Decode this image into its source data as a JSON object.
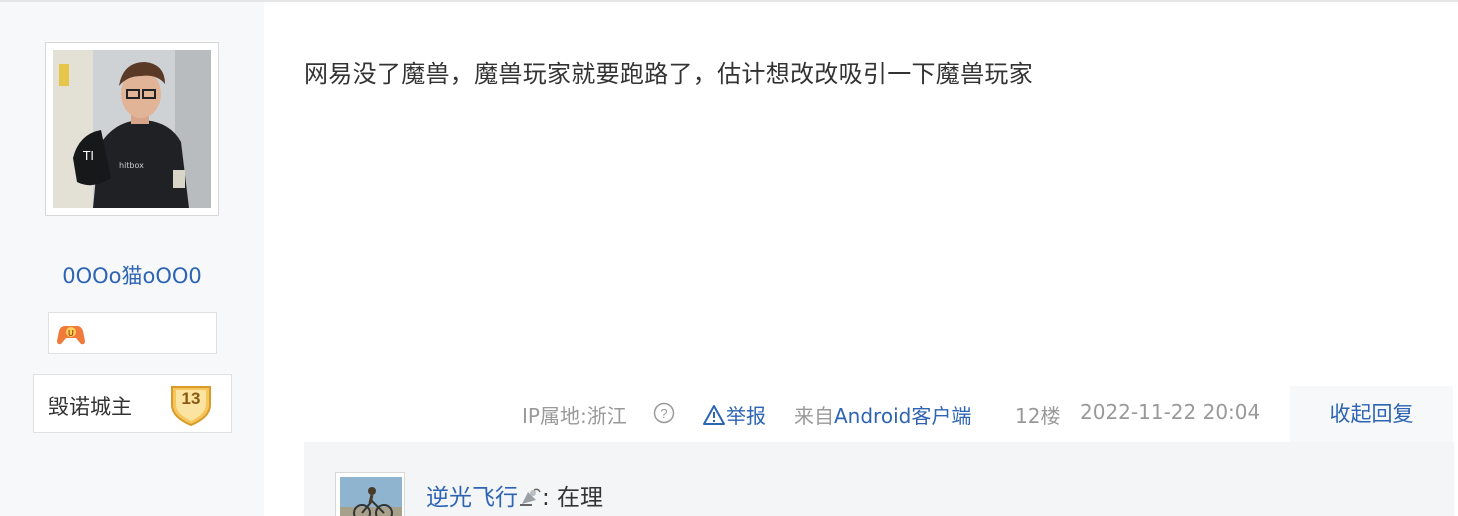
{
  "author": {
    "username": "0OOo猫oOO0",
    "avatar_icon": "user-avatar-photo",
    "badge_icon": "game-controller-badge-icon",
    "level_name": "毁诺城主",
    "level_number": "13"
  },
  "post": {
    "content": "网易没了魔兽，魔兽玩家就要跑路了，估计想改改吸引一下魔兽玩家"
  },
  "meta": {
    "ip_location": "IP属地:浙江",
    "help_icon": "?",
    "report_label": "举报",
    "from_prefix": "来自",
    "from_client": "Android客户端",
    "floor": "12楼",
    "datetime": "2022-11-22 20:04",
    "collapse_label": "收起回复"
  },
  "reply": {
    "username": "逆光飞行",
    "user_emoji_icon": "satellite-emoji-icon",
    "separator": ":",
    "text": " 在理"
  },
  "colors": {
    "link": "#2d64b3",
    "muted": "#999999",
    "sidebar_bg": "#f7f8fa",
    "reply_bg": "#f4f5f7"
  }
}
